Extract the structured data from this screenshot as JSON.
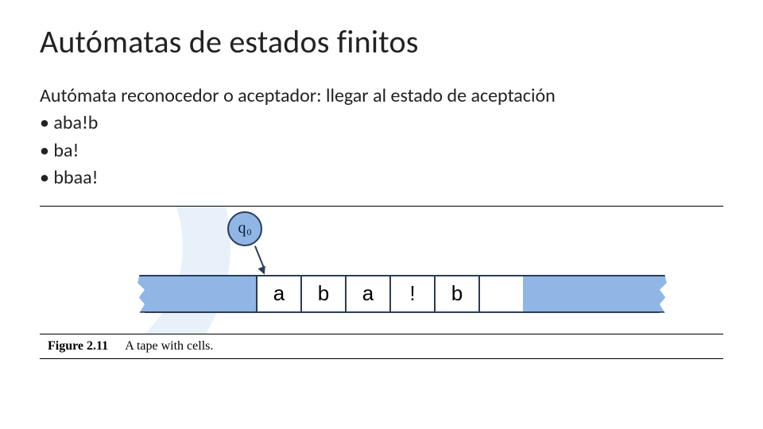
{
  "slide": {
    "title": "Autómatas de estados finitos",
    "intro": "Autómata reconocedor o aceptador: llegar al estado de aceptación",
    "bullets": [
      "aba!b",
      "ba!",
      "bbaa!"
    ]
  },
  "figure": {
    "state_label": {
      "symbol": "q",
      "subscript": "0"
    },
    "tape_cells": [
      "a",
      "b",
      "a",
      "!",
      "b",
      ""
    ],
    "caption_id": "Figure 2.11",
    "caption_text": "A tape with cells."
  }
}
